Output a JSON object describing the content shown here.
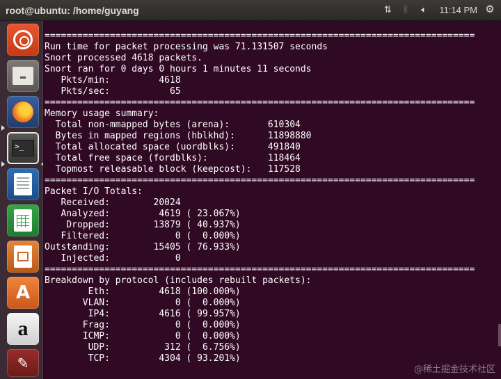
{
  "window": {
    "title": "root@ubuntu: /home/guyang"
  },
  "panel": {
    "network_icon": "network-arrows-icon",
    "bluetooth_icon": "bluetooth-icon",
    "volume_icon": "volume-icon",
    "clock": "11:14 PM",
    "settings_icon": "gear-icon"
  },
  "launcher": {
    "items": [
      {
        "name": "ubuntu-dash",
        "icon": "ubuntu-logo-icon"
      },
      {
        "name": "files",
        "icon": "files-icon"
      },
      {
        "name": "firefox",
        "icon": "firefox-icon"
      },
      {
        "name": "terminal",
        "icon": "terminal-icon",
        "glyph": ">_"
      },
      {
        "name": "libreoffice-writer",
        "icon": "writer-icon"
      },
      {
        "name": "libreoffice-calc",
        "icon": "calc-icon"
      },
      {
        "name": "libreoffice-impress",
        "icon": "impress-icon"
      },
      {
        "name": "ubuntu-software",
        "icon": "software-center-icon",
        "glyph": "A"
      },
      {
        "name": "amazon",
        "icon": "amazon-icon",
        "glyph": "a"
      },
      {
        "name": "system-settings",
        "icon": "settings-icon"
      }
    ]
  },
  "terminal": {
    "lines": [
      "===============================================================================",
      "Run time for packet processing was 71.131507 seconds",
      "Snort processed 4618 packets.",
      "Snort ran for 0 days 0 hours 1 minutes 11 seconds",
      "   Pkts/min:         4618",
      "   Pkts/sec:           65",
      "===============================================================================",
      "Memory usage summary:",
      "  Total non-mmapped bytes (arena):       610304",
      "  Bytes in mapped regions (hblkhd):      11898880",
      "  Total allocated space (uordblks):      491840",
      "  Total free space (fordblks):           118464",
      "  Topmost releasable block (keepcost):   117528",
      "===============================================================================",
      "Packet I/O Totals:",
      "   Received:        20024",
      "   Analyzed:         4619 ( 23.067%)",
      "    Dropped:        13879 ( 40.937%)",
      "   Filtered:            0 (  0.000%)",
      "Outstanding:        15405 ( 76.933%)",
      "   Injected:            0",
      "===============================================================================",
      "Breakdown by protocol (includes rebuilt packets):",
      "        Eth:         4618 (100.000%)",
      "       VLAN:            0 (  0.000%)",
      "        IP4:         4616 ( 99.957%)",
      "       Frag:            0 (  0.000%)",
      "       ICMP:            0 (  0.000%)",
      "        UDP:          312 (  6.756%)",
      "        TCP:         4304 ( 93.201%)"
    ]
  },
  "watermark": "@稀土掘金技术社区"
}
